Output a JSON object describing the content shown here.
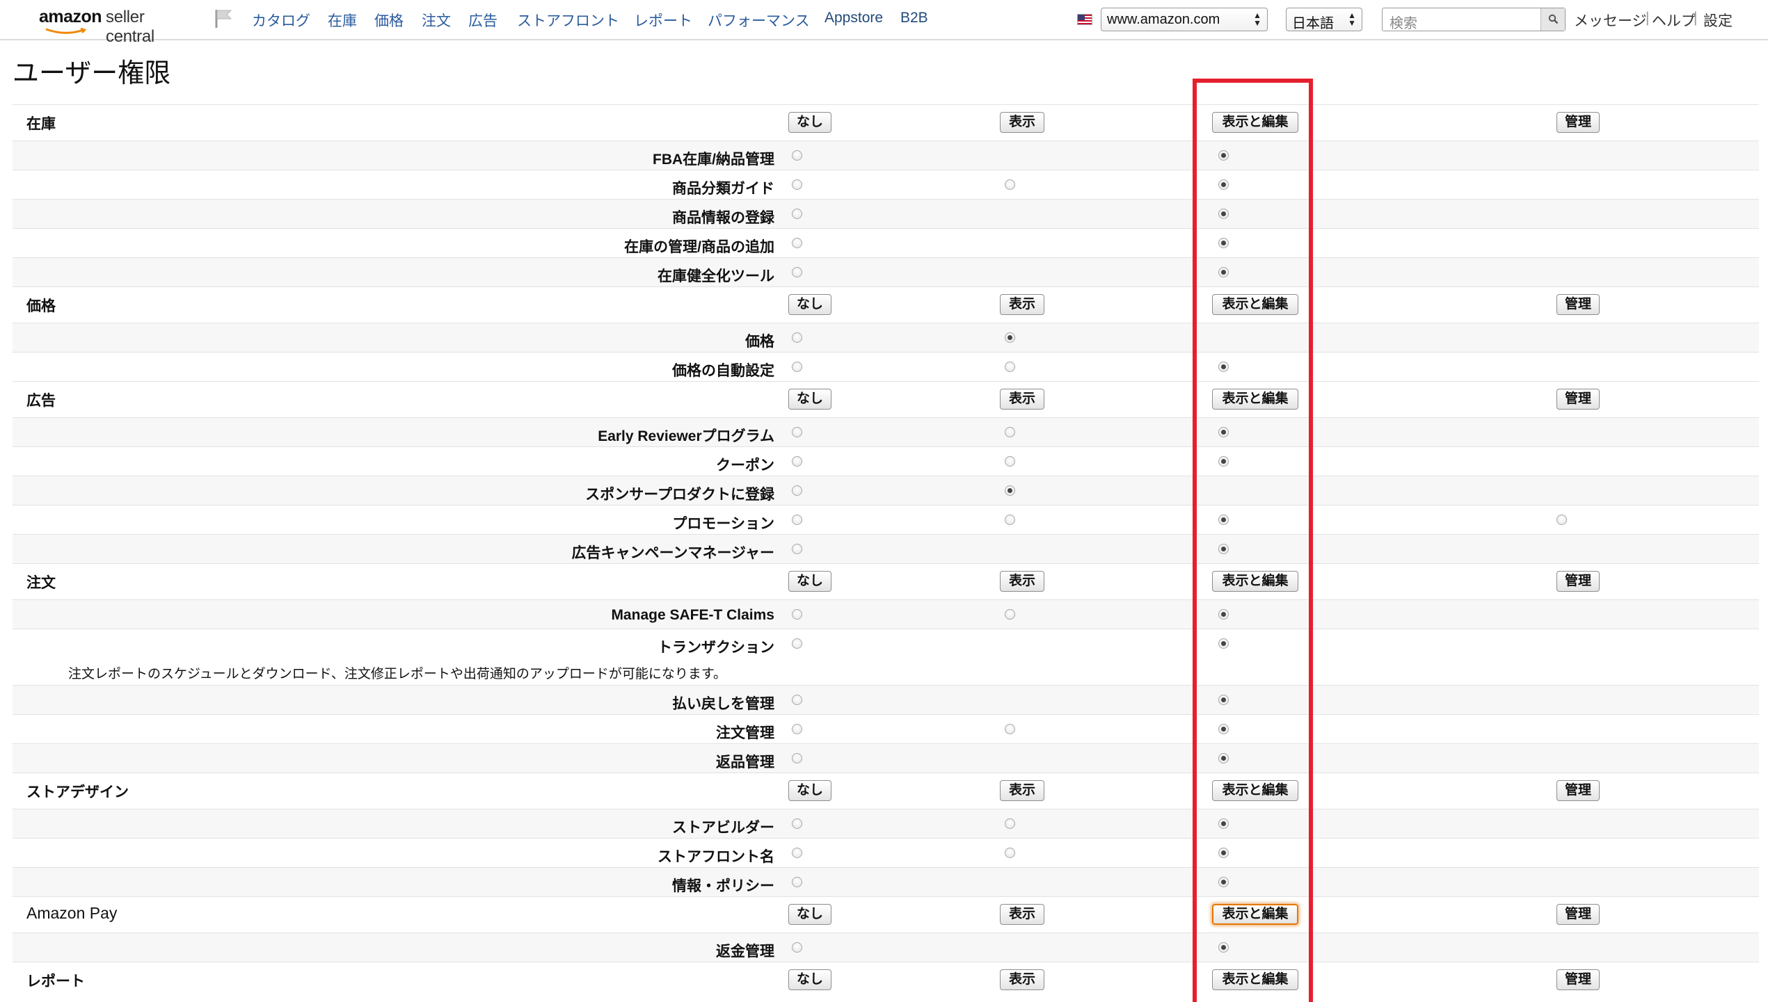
{
  "header": {
    "logo_amazon": "amazon",
    "logo_sc": "seller central",
    "nav": [
      "カタログ",
      "在庫",
      "価格",
      "注文",
      "広告",
      "ストアフロント",
      "レポート",
      "パフォーマンス",
      "Appstore",
      "B2B"
    ],
    "marketplace": "www.amazon.com",
    "language": "日本語",
    "search_placeholder": "検索",
    "messages": "メッセージ",
    "help": "ヘルプ",
    "settings": "設定",
    "sep": "|"
  },
  "page": {
    "title": "ユーザー権限"
  },
  "columns": {
    "none": "なし",
    "view": "表示",
    "edit": "表示と編集",
    "admin": "管理"
  },
  "sections": [
    {
      "label": "在庫",
      "items": [
        {
          "label": "FBA在庫/納品管理",
          "radios": [
            "none",
            "edit"
          ],
          "selected": "edit"
        },
        {
          "label": "商品分類ガイド",
          "radios": [
            "none",
            "view",
            "edit"
          ],
          "selected": "edit"
        },
        {
          "label": "商品情報の登録",
          "radios": [
            "none",
            "edit"
          ],
          "selected": "edit"
        },
        {
          "label": "在庫の管理/商品の追加",
          "radios": [
            "none",
            "edit"
          ],
          "selected": "edit"
        },
        {
          "label": "在庫健全化ツール",
          "radios": [
            "none",
            "edit"
          ],
          "selected": "edit"
        }
      ]
    },
    {
      "label": "価格",
      "items": [
        {
          "label": "価格",
          "radios": [
            "none",
            "view"
          ],
          "selected": "view"
        },
        {
          "label": "価格の自動設定",
          "radios": [
            "none",
            "view",
            "edit"
          ],
          "selected": "edit"
        }
      ]
    },
    {
      "label": "広告",
      "items": [
        {
          "label": "Early Reviewerプログラム",
          "radios": [
            "none",
            "view",
            "edit"
          ],
          "selected": "edit"
        },
        {
          "label": "クーポン",
          "radios": [
            "none",
            "view",
            "edit"
          ],
          "selected": "edit"
        },
        {
          "label": "スポンサープロダクトに登録",
          "radios": [
            "none",
            "view"
          ],
          "selected": "view"
        },
        {
          "label": "プロモーション",
          "radios": [
            "none",
            "view",
            "edit",
            "admin"
          ],
          "selected": "edit"
        },
        {
          "label": "広告キャンペーンマネージャー",
          "radios": [
            "none",
            "edit"
          ],
          "selected": "edit"
        }
      ]
    },
    {
      "label": "注文",
      "items": [
        {
          "label": "Manage SAFE-T Claims",
          "radios": [
            "none",
            "view",
            "edit"
          ],
          "selected": "edit"
        },
        {
          "label": "トランザクション",
          "radios": [
            "none",
            "edit"
          ],
          "selected": "edit",
          "description": "注文レポートのスケジュールとダウンロード、注文修正レポートや出荷通知のアップロードが可能になります。"
        },
        {
          "label": "払い戻しを管理",
          "radios": [
            "none",
            "edit"
          ],
          "selected": "edit"
        },
        {
          "label": "注文管理",
          "radios": [
            "none",
            "view",
            "edit"
          ],
          "selected": "edit"
        },
        {
          "label": "返品管理",
          "radios": [
            "none",
            "edit"
          ],
          "selected": "edit"
        }
      ]
    },
    {
      "label": "ストアデザイン",
      "items": [
        {
          "label": "ストアビルダー",
          "radios": [
            "none",
            "view",
            "edit"
          ],
          "selected": "edit"
        },
        {
          "label": "ストアフロント名",
          "radios": [
            "none",
            "view",
            "edit"
          ],
          "selected": "edit"
        },
        {
          "label": "情報・ポリシー",
          "radios": [
            "none",
            "edit"
          ],
          "selected": "edit"
        }
      ]
    },
    {
      "label": "Amazon Pay",
      "focused_button": "edit",
      "items": [
        {
          "label": "返金管理",
          "radios": [
            "none",
            "edit"
          ],
          "selected": "edit"
        }
      ]
    },
    {
      "label": "レポート",
      "items": []
    }
  ],
  "colors": {
    "highlight": "#e5202e",
    "focus": "#e77600",
    "link": "#2a5b9e"
  }
}
